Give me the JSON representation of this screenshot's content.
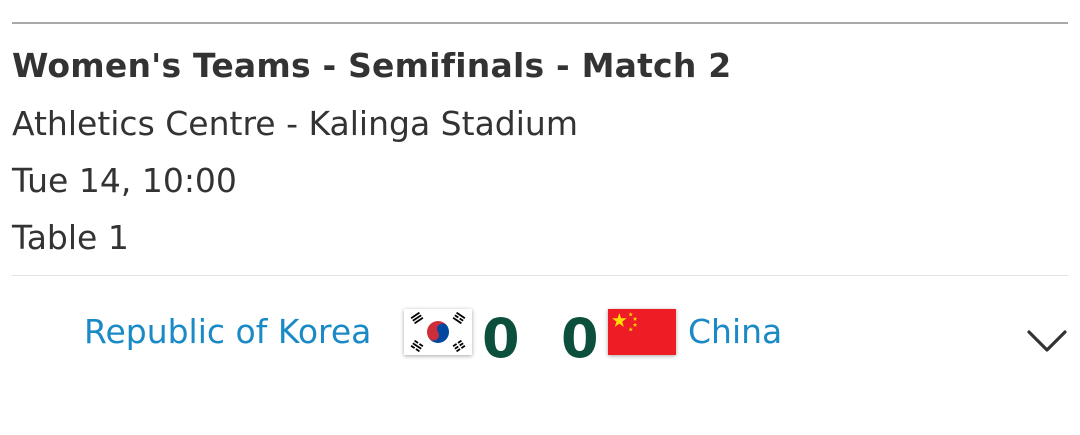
{
  "match": {
    "title": "Women's Teams - Semifinals - Match 2",
    "venue": "Athletics Centre - Kalinga Stadium",
    "datetime": "Tue 14, 10:00",
    "table": "Table 1"
  },
  "teams": {
    "home": {
      "name": "Republic of Korea",
      "score": "0",
      "flag_icon": "south-korea-flag-icon"
    },
    "away": {
      "name": "China",
      "score": "0",
      "flag_icon": "china-flag-icon"
    }
  },
  "colors": {
    "team_name": "#1a8ac6",
    "score": "#0b4f3c",
    "text": "#333333"
  },
  "controls": {
    "expand_icon": "chevron-down-icon"
  }
}
